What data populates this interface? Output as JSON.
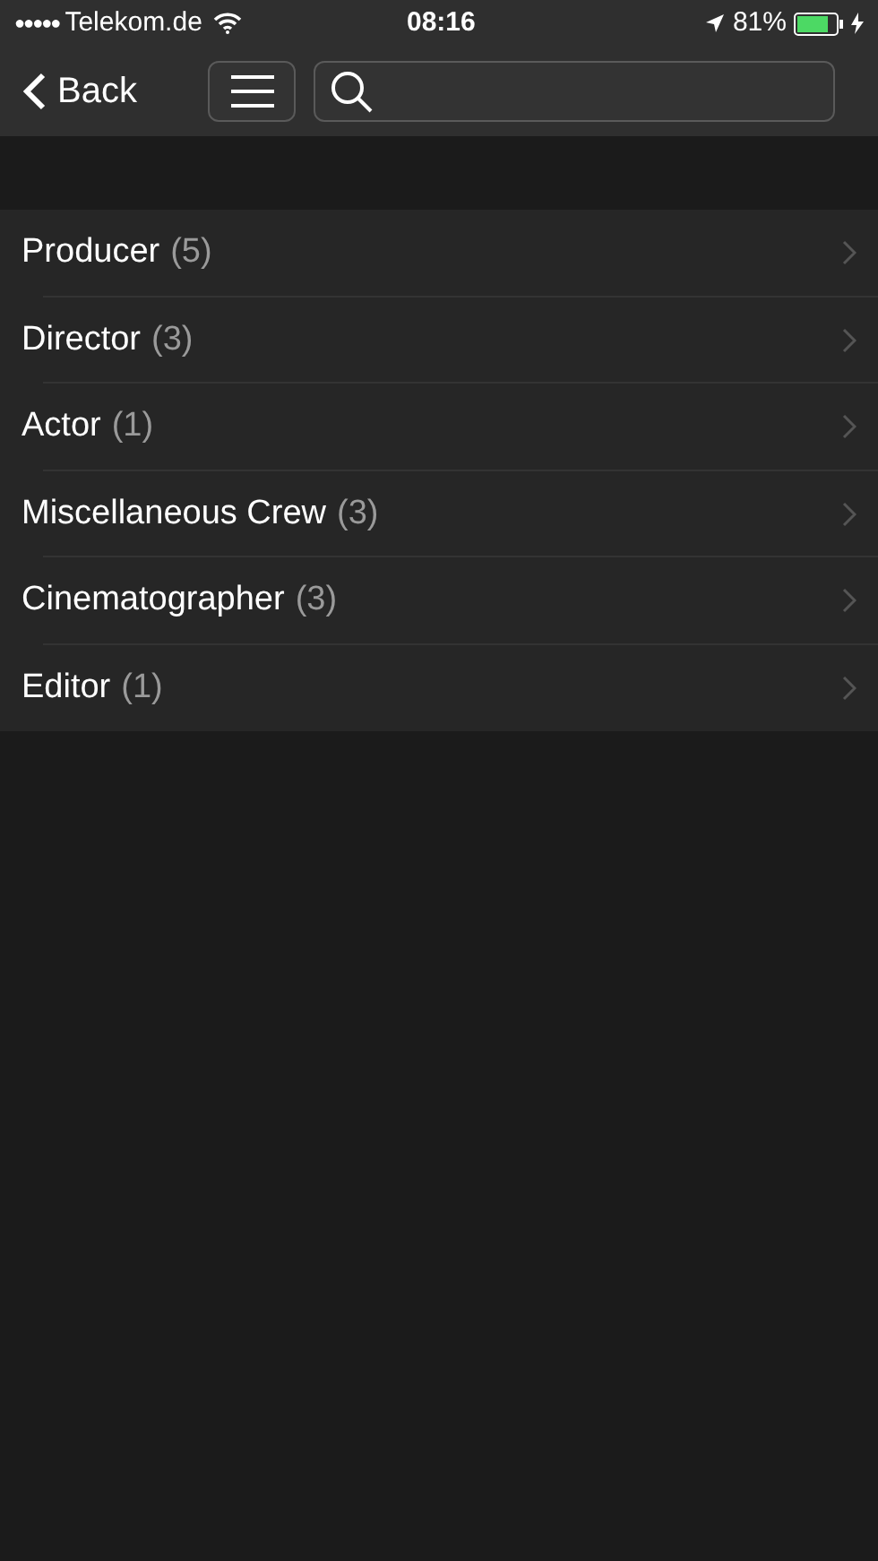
{
  "status_bar": {
    "signal_dots": "●●●●●",
    "carrier": "Telekom.de",
    "time": "08:16",
    "battery": "81%"
  },
  "nav": {
    "back": "Back"
  },
  "list": [
    {
      "label": "Producer",
      "count": "(5)"
    },
    {
      "label": "Director",
      "count": "(3)"
    },
    {
      "label": "Actor",
      "count": "(1)"
    },
    {
      "label": "Miscellaneous Crew",
      "count": "(3)"
    },
    {
      "label": "Cinematographer",
      "count": "(3)"
    },
    {
      "label": "Editor",
      "count": "(1)"
    }
  ]
}
